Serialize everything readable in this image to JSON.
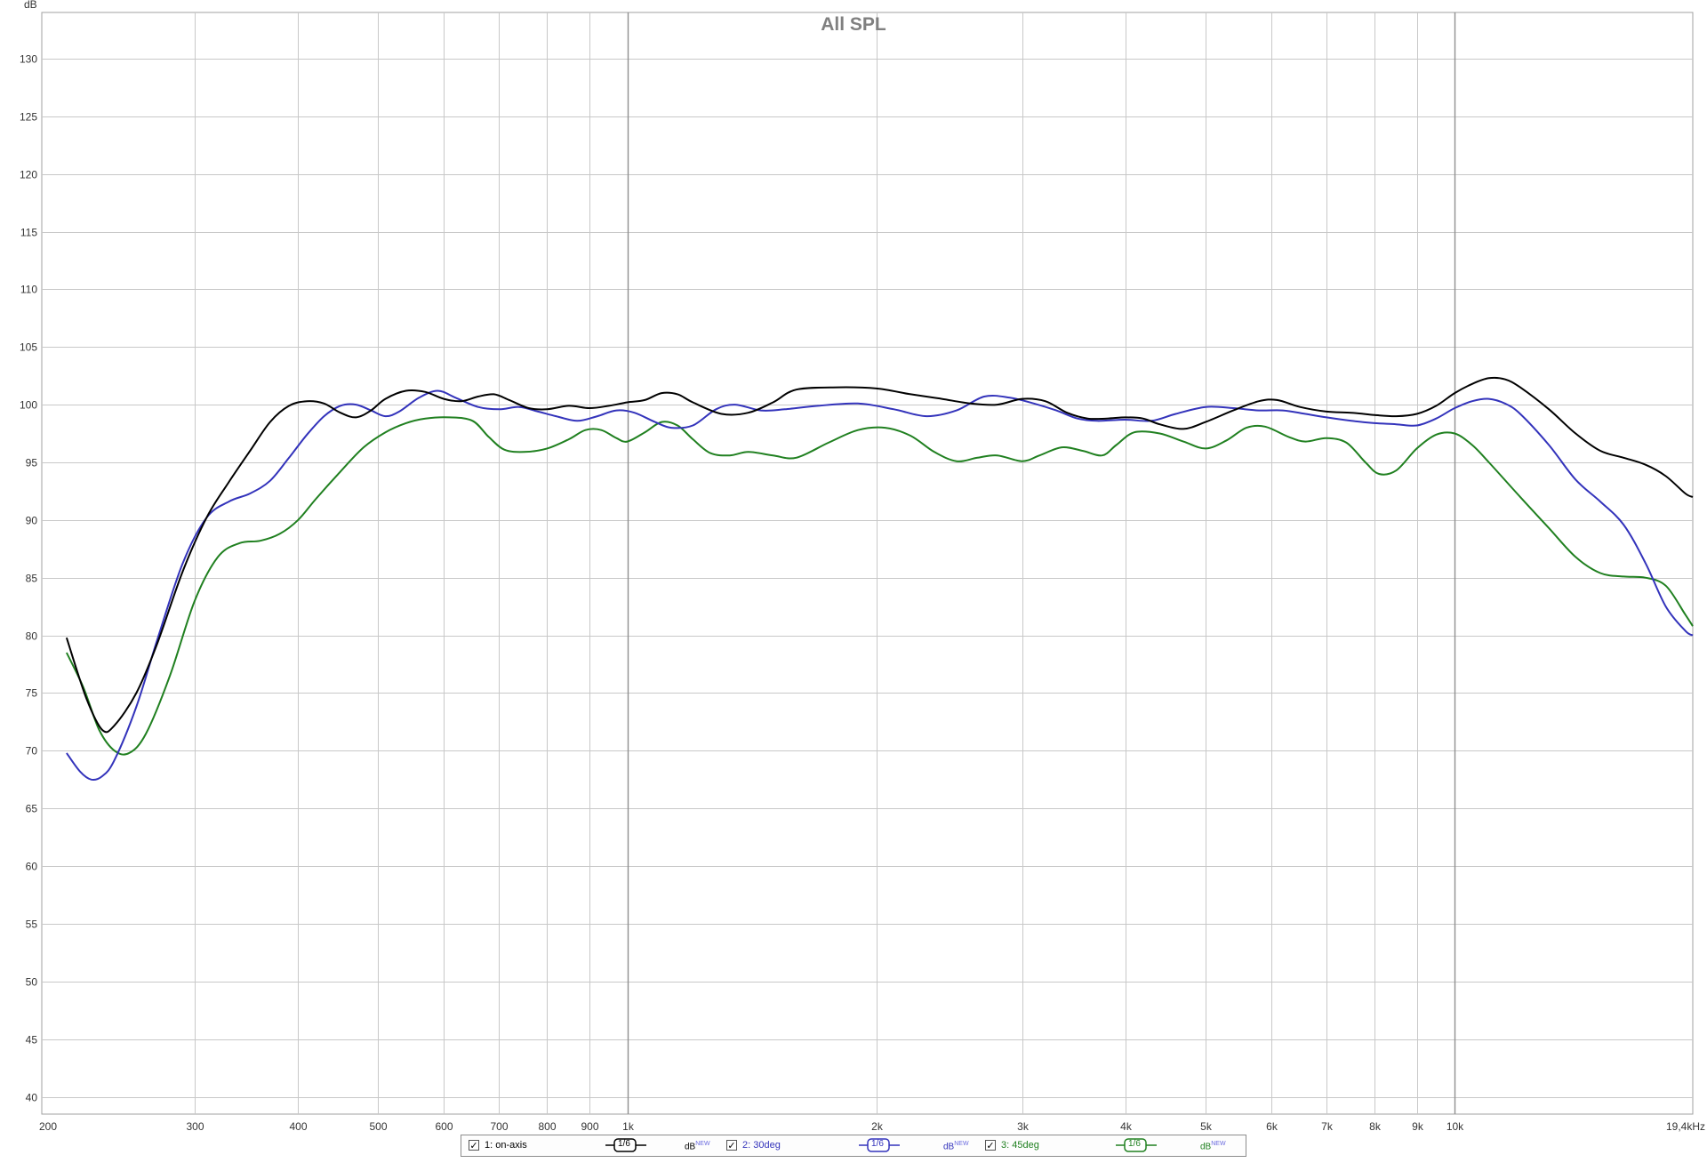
{
  "chart_data": {
    "type": "line",
    "title": "All SPL",
    "ylabel": "dB",
    "xunit": "kHz",
    "xscale": "log",
    "xlim": [
      196,
      19400
    ],
    "ylim": [
      38.5,
      134
    ],
    "grid": true,
    "y_ticks": [
      40,
      45,
      50,
      55,
      60,
      65,
      70,
      75,
      80,
      85,
      90,
      95,
      100,
      105,
      110,
      115,
      120,
      125,
      130
    ],
    "x_ticks": [
      {
        "value": 200,
        "label": "200"
      },
      {
        "value": 300,
        "label": "300"
      },
      {
        "value": 400,
        "label": "400"
      },
      {
        "value": 500,
        "label": "500"
      },
      {
        "value": 600,
        "label": "600"
      },
      {
        "value": 700,
        "label": "700"
      },
      {
        "value": 800,
        "label": "800"
      },
      {
        "value": 900,
        "label": "900"
      },
      {
        "value": 1000,
        "label": "1k"
      },
      {
        "value": 2000,
        "label": "2k"
      },
      {
        "value": 3000,
        "label": "3k"
      },
      {
        "value": 4000,
        "label": "4k"
      },
      {
        "value": 5000,
        "label": "5k"
      },
      {
        "value": 6000,
        "label": "6k"
      },
      {
        "value": 7000,
        "label": "7k"
      },
      {
        "value": 8000,
        "label": "8k"
      },
      {
        "value": 9000,
        "label": "9k"
      },
      {
        "value": 10000,
        "label": "10k"
      },
      {
        "value": 19400,
        "label": "19,4kHz"
      }
    ],
    "series": [
      {
        "name": "1: on-axis",
        "color": "#000000",
        "points": [
          [
            210,
            79.8
          ],
          [
            222,
            74.5
          ],
          [
            232,
            71.8
          ],
          [
            240,
            72.2
          ],
          [
            255,
            75
          ],
          [
            270,
            79.2
          ],
          [
            290,
            85.5
          ],
          [
            310,
            90.2
          ],
          [
            330,
            93.3
          ],
          [
            350,
            96
          ],
          [
            370,
            98.5
          ],
          [
            390,
            99.9
          ],
          [
            410,
            100.3
          ],
          [
            430,
            100.1
          ],
          [
            450,
            99.3
          ],
          [
            470,
            98.9
          ],
          [
            490,
            99.5
          ],
          [
            510,
            100.5
          ],
          [
            540,
            101.2
          ],
          [
            570,
            101.1
          ],
          [
            600,
            100.5
          ],
          [
            630,
            100.3
          ],
          [
            660,
            100.7
          ],
          [
            690,
            100.9
          ],
          [
            720,
            100.4
          ],
          [
            760,
            99.7
          ],
          [
            800,
            99.6
          ],
          [
            850,
            99.9
          ],
          [
            900,
            99.7
          ],
          [
            950,
            99.9
          ],
          [
            1000,
            100.2
          ],
          [
            1050,
            100.4
          ],
          [
            1100,
            101
          ],
          [
            1150,
            100.9
          ],
          [
            1200,
            100.2
          ],
          [
            1300,
            99.2
          ],
          [
            1400,
            99.3
          ],
          [
            1500,
            100.2
          ],
          [
            1600,
            101.3
          ],
          [
            1800,
            101.5
          ],
          [
            2000,
            101.4
          ],
          [
            2200,
            100.9
          ],
          [
            2400,
            100.5
          ],
          [
            2600,
            100.1
          ],
          [
            2800,
            100
          ],
          [
            3000,
            100.5
          ],
          [
            3200,
            100.3
          ],
          [
            3400,
            99.3
          ],
          [
            3600,
            98.8
          ],
          [
            3800,
            98.8
          ],
          [
            4000,
            98.9
          ],
          [
            4200,
            98.8
          ],
          [
            4400,
            98.3
          ],
          [
            4700,
            97.9
          ],
          [
            5000,
            98.5
          ],
          [
            5400,
            99.5
          ],
          [
            5800,
            100.3
          ],
          [
            6100,
            100.4
          ],
          [
            6500,
            99.8
          ],
          [
            7000,
            99.4
          ],
          [
            7500,
            99.3
          ],
          [
            8000,
            99.1
          ],
          [
            8500,
            99
          ],
          [
            9000,
            99.2
          ],
          [
            9500,
            99.9
          ],
          [
            10000,
            101
          ],
          [
            10500,
            101.8
          ],
          [
            11000,
            102.3
          ],
          [
            11500,
            102.2
          ],
          [
            12000,
            101.5
          ],
          [
            13000,
            99.6
          ],
          [
            14000,
            97.5
          ],
          [
            15000,
            96
          ],
          [
            16000,
            95.4
          ],
          [
            17000,
            94.8
          ],
          [
            18000,
            93.8
          ],
          [
            19000,
            92.3
          ],
          [
            19400,
            92
          ]
        ]
      },
      {
        "name": "2: 30deg",
        "color": "#3333bb",
        "points": [
          [
            210,
            69.8
          ],
          [
            218,
            68.2
          ],
          [
            225,
            67.5
          ],
          [
            232,
            67.8
          ],
          [
            240,
            69.2
          ],
          [
            255,
            73.8
          ],
          [
            270,
            79.5
          ],
          [
            290,
            86.2
          ],
          [
            310,
            90.2
          ],
          [
            330,
            91.6
          ],
          [
            350,
            92.3
          ],
          [
            370,
            93.4
          ],
          [
            390,
            95.4
          ],
          [
            410,
            97.4
          ],
          [
            430,
            99
          ],
          [
            450,
            99.9
          ],
          [
            470,
            100
          ],
          [
            490,
            99.5
          ],
          [
            510,
            99
          ],
          [
            530,
            99.4
          ],
          [
            560,
            100.6
          ],
          [
            590,
            101.2
          ],
          [
            620,
            100.6
          ],
          [
            660,
            99.8
          ],
          [
            700,
            99.6
          ],
          [
            740,
            99.8
          ],
          [
            780,
            99.4
          ],
          [
            820,
            99
          ],
          [
            870,
            98.6
          ],
          [
            920,
            99
          ],
          [
            970,
            99.5
          ],
          [
            1020,
            99.3
          ],
          [
            1080,
            98.5
          ],
          [
            1130,
            98
          ],
          [
            1200,
            98.2
          ],
          [
            1280,
            99.6
          ],
          [
            1350,
            100
          ],
          [
            1450,
            99.5
          ],
          [
            1550,
            99.6
          ],
          [
            1700,
            99.9
          ],
          [
            1900,
            100.1
          ],
          [
            2100,
            99.6
          ],
          [
            2300,
            99
          ],
          [
            2500,
            99.5
          ],
          [
            2700,
            100.7
          ],
          [
            2900,
            100.6
          ],
          [
            3100,
            100.1
          ],
          [
            3300,
            99.5
          ],
          [
            3500,
            98.8
          ],
          [
            3700,
            98.6
          ],
          [
            4000,
            98.7
          ],
          [
            4300,
            98.6
          ],
          [
            4600,
            99.2
          ],
          [
            5000,
            99.8
          ],
          [
            5400,
            99.7
          ],
          [
            5800,
            99.5
          ],
          [
            6200,
            99.5
          ],
          [
            6600,
            99.2
          ],
          [
            7000,
            98.9
          ],
          [
            7500,
            98.6
          ],
          [
            8000,
            98.4
          ],
          [
            8500,
            98.3
          ],
          [
            9000,
            98.2
          ],
          [
            9500,
            98.8
          ],
          [
            10000,
            99.7
          ],
          [
            10500,
            100.3
          ],
          [
            11000,
            100.5
          ],
          [
            11500,
            100.1
          ],
          [
            12000,
            99.2
          ],
          [
            13000,
            96.5
          ],
          [
            14000,
            93.5
          ],
          [
            15000,
            91.6
          ],
          [
            16000,
            89.6
          ],
          [
            17000,
            86.3
          ],
          [
            18000,
            82.5
          ],
          [
            19000,
            80.4
          ],
          [
            19400,
            80
          ]
        ]
      },
      {
        "name": "3: 45deg",
        "color": "#208020",
        "points": [
          [
            210,
            78.5
          ],
          [
            220,
            75.5
          ],
          [
            230,
            71.8
          ],
          [
            240,
            70
          ],
          [
            250,
            69.8
          ],
          [
            262,
            71.5
          ],
          [
            280,
            76.5
          ],
          [
            300,
            83
          ],
          [
            320,
            86.8
          ],
          [
            340,
            88
          ],
          [
            360,
            88.2
          ],
          [
            380,
            88.8
          ],
          [
            400,
            90
          ],
          [
            420,
            91.8
          ],
          [
            450,
            94.2
          ],
          [
            480,
            96.3
          ],
          [
            510,
            97.6
          ],
          [
            540,
            98.4
          ],
          [
            570,
            98.8
          ],
          [
            610,
            98.9
          ],
          [
            650,
            98.6
          ],
          [
            680,
            97.2
          ],
          [
            710,
            96.1
          ],
          [
            750,
            95.9
          ],
          [
            800,
            96.2
          ],
          [
            850,
            97
          ],
          [
            890,
            97.8
          ],
          [
            930,
            97.8
          ],
          [
            970,
            97.1
          ],
          [
            1000,
            96.8
          ],
          [
            1050,
            97.6
          ],
          [
            1100,
            98.5
          ],
          [
            1150,
            98.2
          ],
          [
            1200,
            97
          ],
          [
            1260,
            95.8
          ],
          [
            1330,
            95.6
          ],
          [
            1400,
            95.9
          ],
          [
            1500,
            95.6
          ],
          [
            1600,
            95.4
          ],
          [
            1750,
            96.7
          ],
          [
            1900,
            97.8
          ],
          [
            2050,
            98
          ],
          [
            2200,
            97.3
          ],
          [
            2350,
            95.9
          ],
          [
            2500,
            95.1
          ],
          [
            2650,
            95.4
          ],
          [
            2800,
            95.6
          ],
          [
            3000,
            95.1
          ],
          [
            3150,
            95.6
          ],
          [
            3350,
            96.3
          ],
          [
            3550,
            96
          ],
          [
            3750,
            95.6
          ],
          [
            3900,
            96.5
          ],
          [
            4100,
            97.6
          ],
          [
            4400,
            97.5
          ],
          [
            4700,
            96.8
          ],
          [
            5000,
            96.2
          ],
          [
            5300,
            96.9
          ],
          [
            5600,
            98
          ],
          [
            5900,
            98.1
          ],
          [
            6300,
            97.2
          ],
          [
            6600,
            96.8
          ],
          [
            7000,
            97.1
          ],
          [
            7400,
            96.7
          ],
          [
            7800,
            95
          ],
          [
            8100,
            94
          ],
          [
            8500,
            94.3
          ],
          [
            9000,
            96.2
          ],
          [
            9500,
            97.4
          ],
          [
            10000,
            97.5
          ],
          [
            10500,
            96.5
          ],
          [
            11000,
            95
          ],
          [
            12000,
            92
          ],
          [
            13000,
            89.3
          ],
          [
            14000,
            86.8
          ],
          [
            15000,
            85.4
          ],
          [
            16000,
            85.1
          ],
          [
            17000,
            85
          ],
          [
            18000,
            84.3
          ],
          [
            19000,
            81.8
          ],
          [
            19400,
            80.8
          ]
        ]
      }
    ]
  },
  "legend": [
    {
      "label": "1: on-axis",
      "checked": "✓",
      "smoothing": "1/6",
      "unit": "dB",
      "tag": "NEW",
      "color": "#000000"
    },
    {
      "label": "2: 30deg",
      "checked": "✓",
      "smoothing": "1/6",
      "unit": "dB",
      "tag": "NEW",
      "color": "#3333bb"
    },
    {
      "label": "3: 45deg",
      "checked": "✓",
      "smoothing": "1/6",
      "unit": "dB",
      "tag": "NEW",
      "color": "#208020"
    }
  ]
}
